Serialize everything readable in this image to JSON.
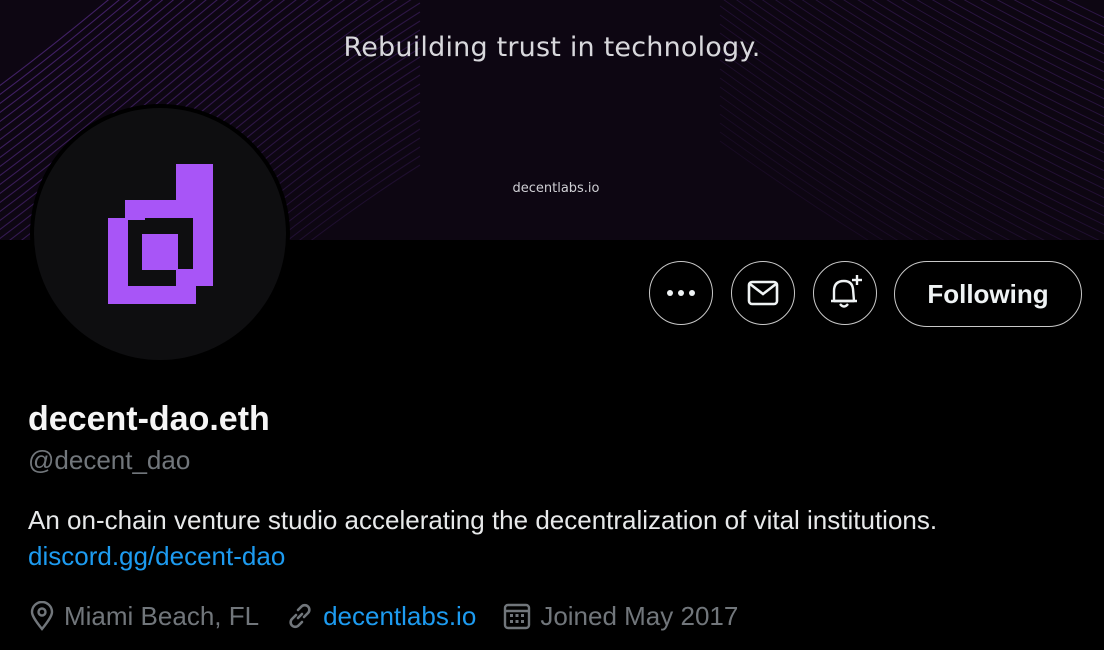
{
  "banner": {
    "tagline": "Rebuilding trust in technology.",
    "url": "decentlabs.io"
  },
  "avatar": {
    "icon": "decent-dao-logo",
    "accent": "#a855f7"
  },
  "actions": {
    "more_icon": "more-icon",
    "message_icon": "mail-icon",
    "notify_icon": "bell-plus-icon",
    "follow_label": "Following"
  },
  "profile": {
    "name": "decent-dao.eth",
    "handle": "@decent_dao",
    "bio": "An on-chain venture studio accelerating the decentralization of vital institutions.",
    "bio_link": "discord.gg/decent-dao"
  },
  "meta": {
    "location": "Miami Beach, FL",
    "website": "decentlabs.io",
    "joined": "Joined May 2017"
  },
  "colors": {
    "link": "#1d9bf0",
    "muted": "#71767b",
    "banner_line": "#6b36a8"
  }
}
